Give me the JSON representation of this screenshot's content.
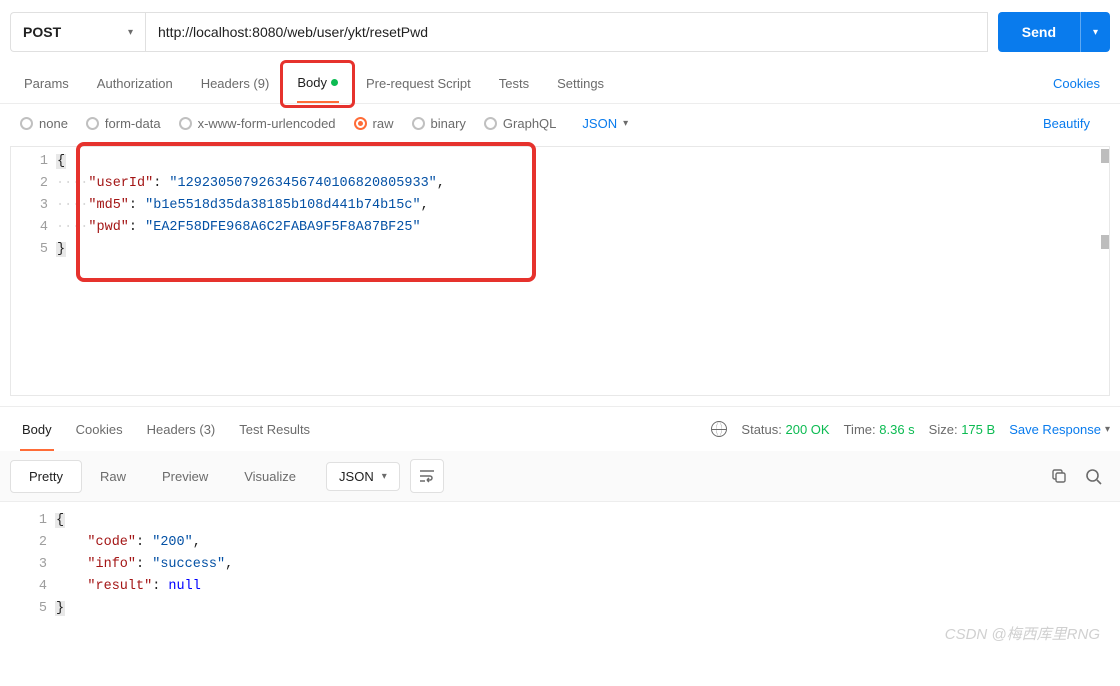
{
  "request": {
    "method": "POST",
    "url": "http://localhost:8080/web/user/ykt/resetPwd",
    "send_label": "Send"
  },
  "tabs": {
    "params": "Params",
    "auth": "Authorization",
    "headers": "Headers (9)",
    "body": "Body",
    "prereq": "Pre-request Script",
    "tests": "Tests",
    "settings": "Settings",
    "cookies": "Cookies"
  },
  "body_types": {
    "none": "none",
    "formdata": "form-data",
    "urlenc": "x-www-form-urlencoded",
    "raw": "raw",
    "binary": "binary",
    "graphql": "GraphQL",
    "format": "JSON",
    "beautify": "Beautify"
  },
  "req_body": {
    "line1": "{",
    "line2_key": "\"userId\"",
    "line2_val": "\"1292305079263456740106820805933\"",
    "line3_key": "\"md5\"",
    "line3_val": "\"b1e5518d35da38185b108d441b74b15c\"",
    "line4_key": "\"pwd\"",
    "line4_val": "\"EA2F58DFE968A6C2FABA9F5F8A87BF25\"",
    "line5": "}"
  },
  "resp_tabs": {
    "body": "Body",
    "cookies": "Cookies",
    "headers": "Headers (3)",
    "test": "Test Results"
  },
  "resp_meta": {
    "status_lbl": "Status:",
    "status_val": "200 OK",
    "time_lbl": "Time:",
    "time_val": "8.36 s",
    "size_lbl": "Size:",
    "size_val": "175 B",
    "save": "Save Response"
  },
  "view": {
    "pretty": "Pretty",
    "raw": "Raw",
    "preview": "Preview",
    "visualize": "Visualize",
    "format": "JSON"
  },
  "resp_body": {
    "line1": "{",
    "line2_key": "\"code\"",
    "line2_val": "\"200\"",
    "line3_key": "\"info\"",
    "line3_val": "\"success\"",
    "line4_key": "\"result\"",
    "line4_val": "null",
    "line5": "}"
  },
  "watermark": "CSDN @梅西库里RNG"
}
